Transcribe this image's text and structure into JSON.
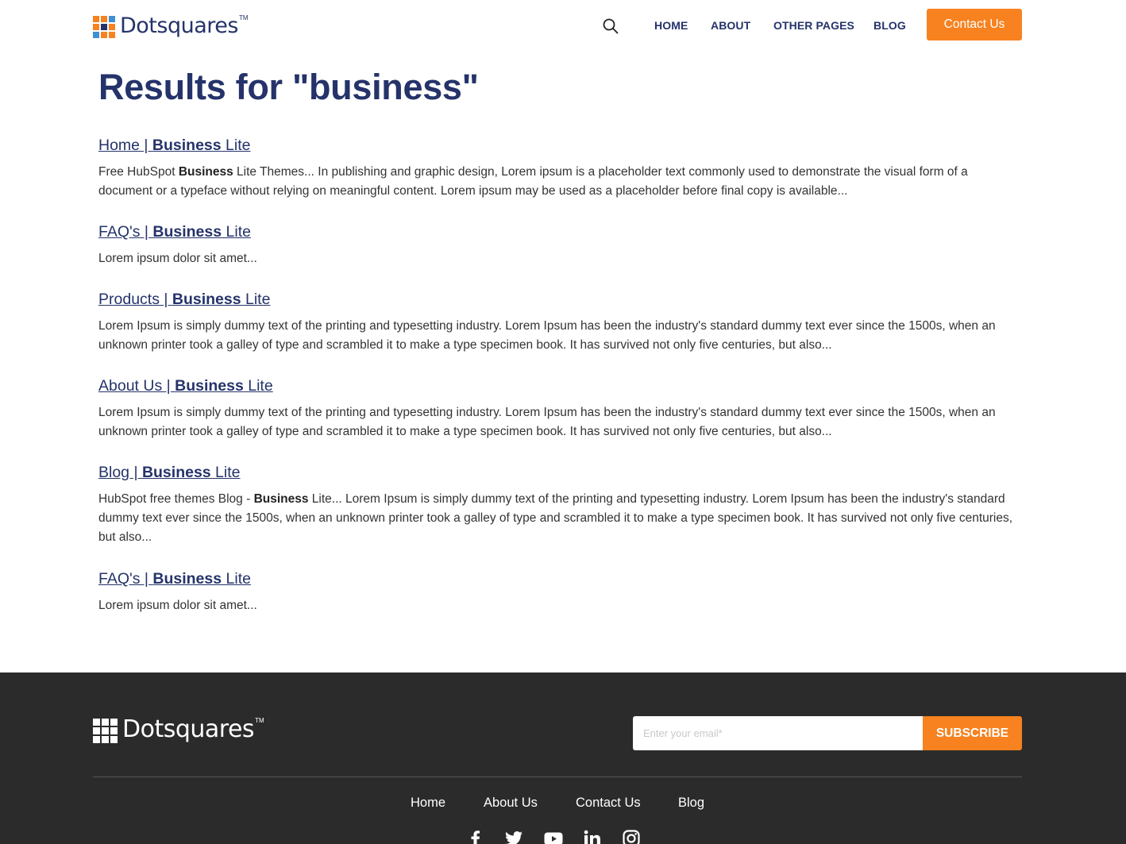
{
  "header": {
    "logo_text": "Dotsquares",
    "logo_tm": "TM",
    "nav": [
      "HOME",
      "ABOUT",
      "OTHER PAGES",
      "BLOG"
    ],
    "contact_label": "Contact Us"
  },
  "main": {
    "title": "Results for \"business\"",
    "results": [
      {
        "link_pre": "Home | ",
        "link_bold": "Business",
        "link_post": " Lite",
        "snip_pre": "Free HubSpot ",
        "snip_bold": "Business",
        "snip_post": " Lite Themes... In publishing and graphic design, Lorem ipsum is a placeholder text commonly used to demonstrate the visual form of a document or a typeface without relying on meaningful content. Lorem ipsum may be used as a placeholder before final copy is available..."
      },
      {
        "link_pre": "FAQ's | ",
        "link_bold": "Business",
        "link_post": " Lite",
        "snip_pre": "Lorem ipsum dolor sit amet...",
        "snip_bold": "",
        "snip_post": ""
      },
      {
        "link_pre": "Products | ",
        "link_bold": "Business",
        "link_post": " Lite",
        "snip_pre": "Lorem Ipsum is simply dummy text of the printing and typesetting industry. Lorem Ipsum has been the industry's standard dummy text ever since the 1500s, when an unknown printer took a galley of type and scrambled it to make a type specimen book. It has survived not only five centuries, but also...",
        "snip_bold": "",
        "snip_post": ""
      },
      {
        "link_pre": "About Us | ",
        "link_bold": "Business",
        "link_post": " Lite",
        "snip_pre": "Lorem Ipsum is simply dummy text of the printing and typesetting industry. Lorem Ipsum has been the industry's standard dummy text ever since the 1500s, when an unknown printer took a galley of type and scrambled it to make a type specimen book. It has survived not only five centuries, but also...",
        "snip_bold": "",
        "snip_post": ""
      },
      {
        "link_pre": "Blog | ",
        "link_bold": "Business",
        "link_post": " Lite",
        "snip_pre": "HubSpot free themes Blog - ",
        "snip_bold": "Business",
        "snip_post": " Lite... Lorem Ipsum is simply dummy text of the printing and typesetting industry. Lorem Ipsum has been the industry's standard dummy text ever since the 1500s, when an unknown printer took a galley of type and scrambled it to make a type specimen book. It has survived not only five centuries, but also..."
      },
      {
        "link_pre": "FAQ's | ",
        "link_bold": "Business",
        "link_post": " Lite",
        "snip_pre": "Lorem ipsum dolor sit amet...",
        "snip_bold": "",
        "snip_post": ""
      }
    ]
  },
  "footer": {
    "logo_text": "Dotsquares",
    "logo_tm": "TM",
    "email_placeholder": "Enter your email*",
    "subscribe_label": "SUBSCRIBE",
    "nav": [
      "Home",
      "About Us",
      "Contact Us",
      "Blog"
    ],
    "social": [
      "facebook-icon",
      "twitter-icon",
      "youtube-icon",
      "linkedin-icon",
      "instagram-icon"
    ]
  },
  "colors": {
    "brand_navy": "#25336a",
    "accent_orange": "#f7821f",
    "logo_blue": "#3f8fd2",
    "footer_bg": "#2b2b2b"
  }
}
